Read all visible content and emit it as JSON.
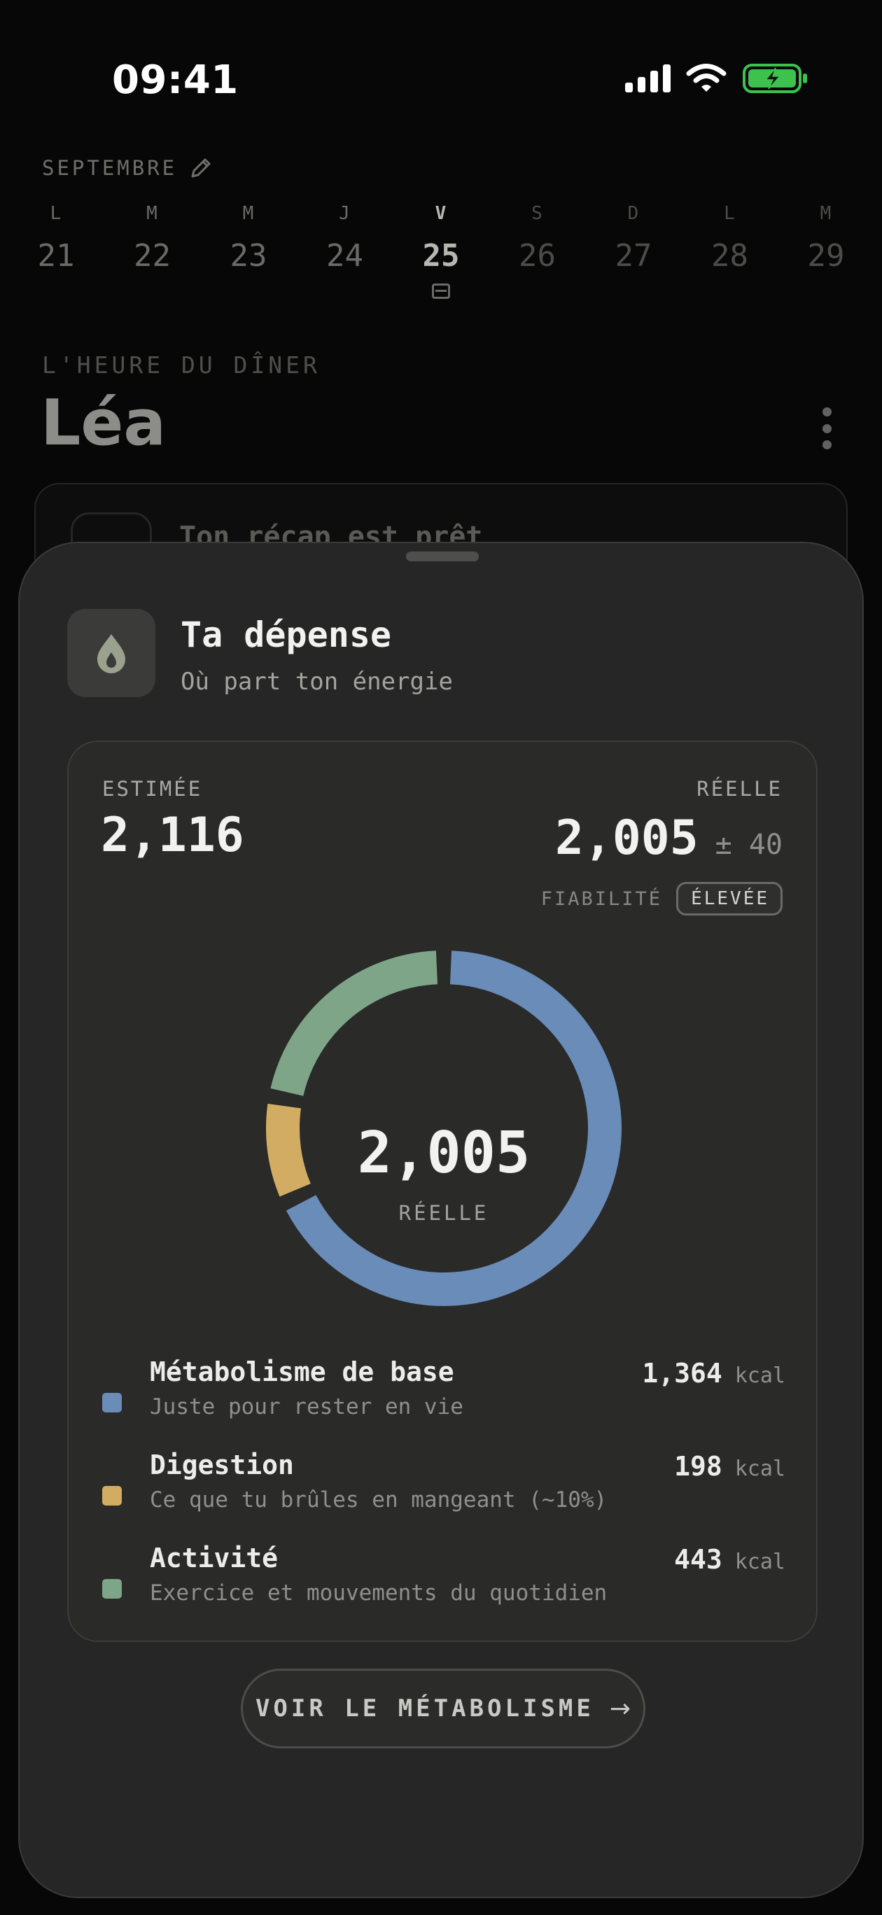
{
  "status_bar": {
    "time": "09:41"
  },
  "calendar": {
    "month": "SEPTEMBRE",
    "days": [
      {
        "letter": "L",
        "number": "21"
      },
      {
        "letter": "M",
        "number": "22"
      },
      {
        "letter": "M",
        "number": "23"
      },
      {
        "letter": "J",
        "number": "24"
      },
      {
        "letter": "V",
        "number": "25"
      },
      {
        "letter": "S",
        "number": "26"
      },
      {
        "letter": "D",
        "number": "27"
      },
      {
        "letter": "L",
        "number": "28"
      },
      {
        "letter": "M",
        "number": "29"
      }
    ],
    "selected_index": 4
  },
  "dinner": {
    "eyebrow": "L'HEURE DU DÎNER",
    "name": "Léa",
    "card_title": "Ton récap est prêt"
  },
  "sheet": {
    "title": "Ta dépense",
    "subtitle": "Où part ton énergie",
    "icon": "flame-icon",
    "estimated": {
      "label": "ESTIMÉE",
      "value": "2,116"
    },
    "actual": {
      "label": "RÉELLE",
      "value": "2,005",
      "margin": "± 40"
    },
    "reliability": {
      "label": "FIABILITÉ",
      "badge": "ÉLEVÉE"
    },
    "donut": {
      "center_value": "2,005",
      "center_label": "RÉELLE"
    },
    "breakdown": [
      {
        "name": "Métabolisme de base",
        "desc": "Juste pour rester en vie",
        "value": "1,364",
        "unit": "kcal",
        "color": "#6a8cb8"
      },
      {
        "name": "Digestion",
        "desc": "Ce que tu brûles en mangeant (~10%)",
        "value": "198",
        "unit": "kcal",
        "color": "#d2ac62"
      },
      {
        "name": "Activité",
        "desc": "Exercice et mouvements du quotidien",
        "value": "443",
        "unit": "kcal",
        "color": "#7ea587"
      }
    ],
    "cta": {
      "label": "VOIR LE MÉTABOLISME"
    }
  },
  "chart_data": {
    "type": "pie",
    "categories": [
      "Métabolisme de base",
      "Digestion",
      "Activité"
    ],
    "values": [
      1364,
      198,
      443
    ],
    "colors": [
      "#6a8cb8",
      "#d2ac62",
      "#7ea587"
    ],
    "center_text": "2,005",
    "center_label": "RÉELLE"
  }
}
